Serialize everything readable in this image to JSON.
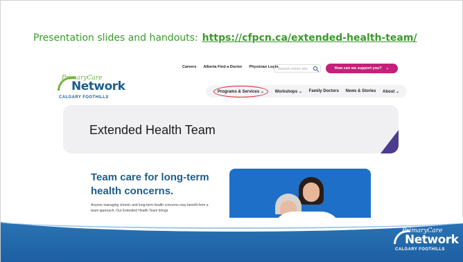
{
  "slide": {
    "caption_label": "Presentation slides and handouts:",
    "caption_link": "https://cfpcn.ca/extended-health-team/"
  },
  "site": {
    "logo": {
      "primary_care": "PrimaryCare",
      "network": "Network",
      "subtitle": "CALGARY FOOTHILLS"
    },
    "top_nav": [
      "Careers",
      "Alberta Find a Doctor",
      "Physician Login"
    ],
    "search_placeholder": "Search entire site",
    "help_button": "How can we support you?",
    "main_nav": [
      "Programs & Services",
      "Workshops",
      "Family Doctors",
      "News & Stories",
      "About"
    ],
    "hero_title": "Extended Health Team",
    "section_title": "Team care for long-term health concerns.",
    "section_body": "Anyone managing chronic and long-term health concerns may benefit from a team approach. Our Extended Health Team brings"
  },
  "footer_logo": {
    "primary_care": "PrimaryCare",
    "network": "Network",
    "subtitle": "CALGARY FOOTHILLS"
  },
  "colors": {
    "accent_green": "#3a9a2a",
    "brand_blue": "#1e5e8c",
    "cta_pink": "#c4207a",
    "band_blue": "#2b75b5"
  }
}
